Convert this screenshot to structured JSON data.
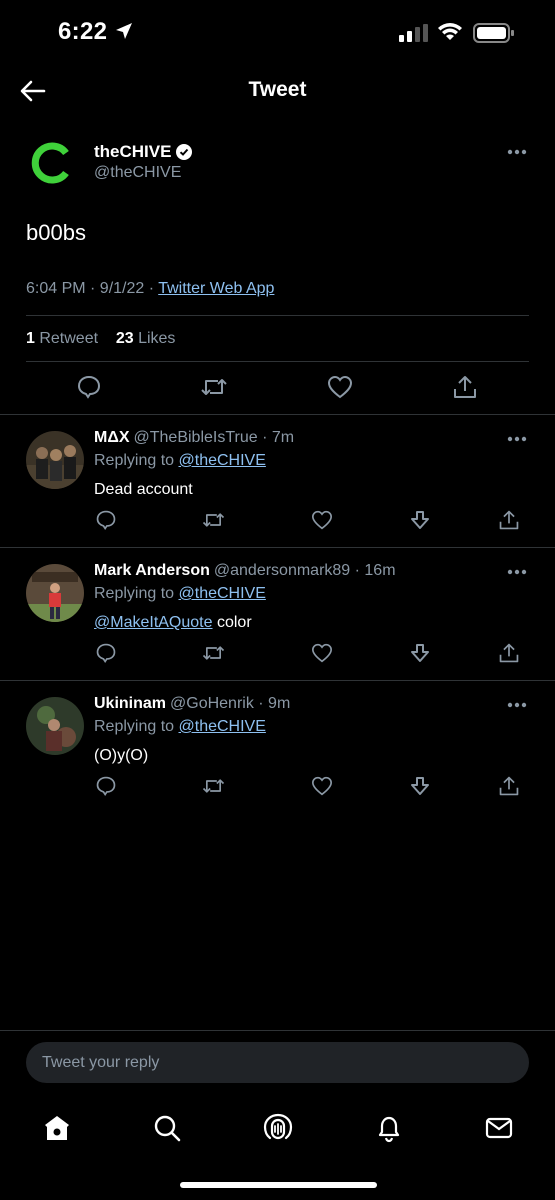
{
  "status_bar": {
    "time": "6:22"
  },
  "header": {
    "title": "Tweet"
  },
  "main_tweet": {
    "author_name": "theCHIVE",
    "author_handle": "@theCHIVE",
    "text": "b00bs",
    "timestamp": "6:04 PM · 9/1/22 · ",
    "source": "Twitter Web App",
    "retweet_count": "1",
    "retweet_label": " Retweet",
    "like_count": "23",
    "like_label": " Likes",
    "avatar_color": "#3fd13a"
  },
  "replies": [
    {
      "name": "MΔX",
      "handle": "@TheBibleIsTrue · 7m",
      "replying_prefix": "Replying to ",
      "replying_to": "@theCHIVE",
      "text": "Dead account",
      "mention": ""
    },
    {
      "name": "Mark Anderson",
      "handle": "@andersonmark89 · 16m",
      "replying_prefix": "Replying to ",
      "replying_to": "@theCHIVE",
      "mention": "@MakeItAQuote",
      "text": " color"
    },
    {
      "name": "Ukininam",
      "handle": "@GoHenrik · 9m",
      "replying_prefix": "Replying to ",
      "replying_to": "@theCHIVE",
      "text": "(O)y(O)",
      "mention": ""
    }
  ],
  "compose": {
    "placeholder": "Tweet your reply"
  },
  "colors": {
    "link": "#8ec0f0",
    "muted": "#8b98a5",
    "divider": "#2f3336"
  }
}
